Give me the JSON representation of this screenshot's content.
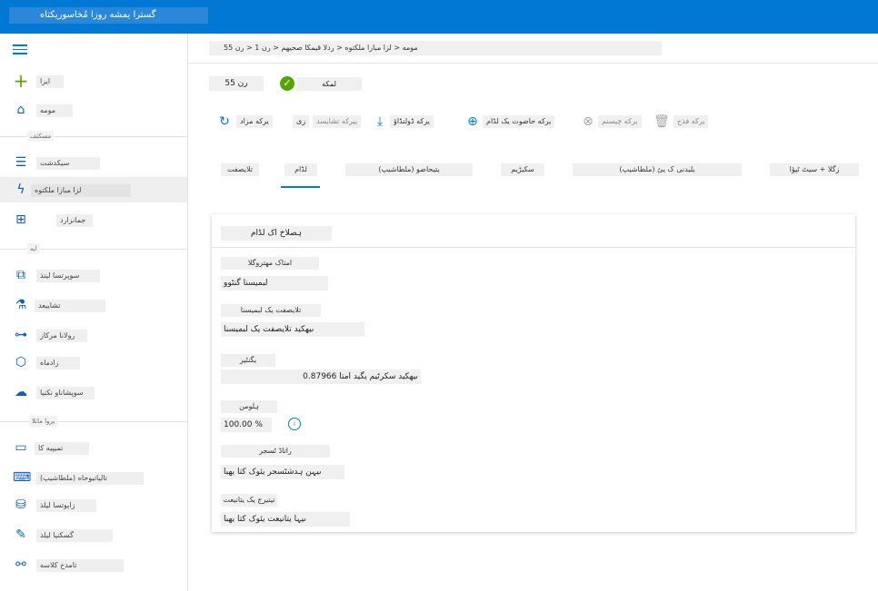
{
  "app": {
    "title": "گسترا یمشه روزا مُخاسوریکتاه"
  },
  "sidebar": {
    "items": [
      {
        "label": "ایزا",
        "icon": "plus-icon"
      },
      {
        "label": "مومه",
        "icon": "home-icon"
      },
      {
        "label": "سیکدشت",
        "icon": "notebook-icon"
      },
      {
        "label": "لزا مبازا ملکتوه",
        "icon": "automated-ml-icon"
      },
      {
        "label": "جمانزارد",
        "icon": "designer-icon"
      },
      {
        "label": "سوپرتسا لیتذ",
        "icon": "datasets-icon"
      },
      {
        "label": "تشاییعد",
        "icon": "experiments-icon"
      },
      {
        "label": "رولانا مرکاز",
        "icon": "pipelines-icon"
      },
      {
        "label": "زادماه",
        "icon": "models-icon"
      },
      {
        "label": "سوپشاناو نکنیا",
        "icon": "endpoints-icon"
      },
      {
        "label": "تمیپیه کا",
        "icon": "compute-icon"
      },
      {
        "label": "(ملطاشیپ) تالیاتیوحاه",
        "icon": "environments-icon"
      },
      {
        "label": "زاپوتسا لیلذ",
        "icon": "datastores-icon"
      },
      {
        "label": "گسکنیا لیلذ",
        "icon": "labeling-icon"
      },
      {
        "label": "تامدخ کلاسه",
        "icon": "linked-services-icon"
      }
    ],
    "sections": [
      "مسکتف",
      "ایه",
      "یروا ماتلا"
    ]
  },
  "breadcrumb": "مومه < لزا مبازا ملکتوه < ردلا قیمکا صحیهم < رن 1 < رن 55",
  "run": {
    "name": "رن 55",
    "status": "لمکه"
  },
  "toolbar": {
    "refresh": "یرکه مزاد",
    "stop_label": "زی",
    "edit": "ییرکه تشایسد",
    "download": "یرکه ڈولنڈاؤ",
    "explain": "یرکه حاضوت یک لڈام",
    "cancel": "یرکه چیسنم",
    "delete": "یرکه فذح"
  },
  "tabs": [
    "تلایصفت",
    "لڈام",
    "(ملطاشیپ) یتیحاضو",
    "سکیڑیم",
    "(ملطاشیپ) یلیدنی ک یئ",
    "زگلا + سیٹ ٹپؤا"
  ],
  "card": {
    "title": "ہصلاخ اک لڈام",
    "properties": [
      {
        "label": "امتاک مھتروگلا",
        "value": "لبمیسنا گنٹوو"
      },
      {
        "label": "تلایصفت یک لبمیسنا",
        "value": "ںیھکید تلایصفت یک لبمیسنا"
      },
      {
        "label": "یگنٹیر",
        "value": "ںیھکید سکرٹیم یگید امتا 0.87966"
      },
      {
        "label": "ہلومن",
        "value": "100.00 %"
      },
      {
        "label": "راتاڈ ٹسجر",
        "value": "ںیہن ہدشٹسجر یئوک کتا یھبا"
      },
      {
        "label": "تیتیرج یک یتانیعت",
        "value": "ںیہا یتانیعت یئوک کتا یھبا"
      }
    ]
  }
}
